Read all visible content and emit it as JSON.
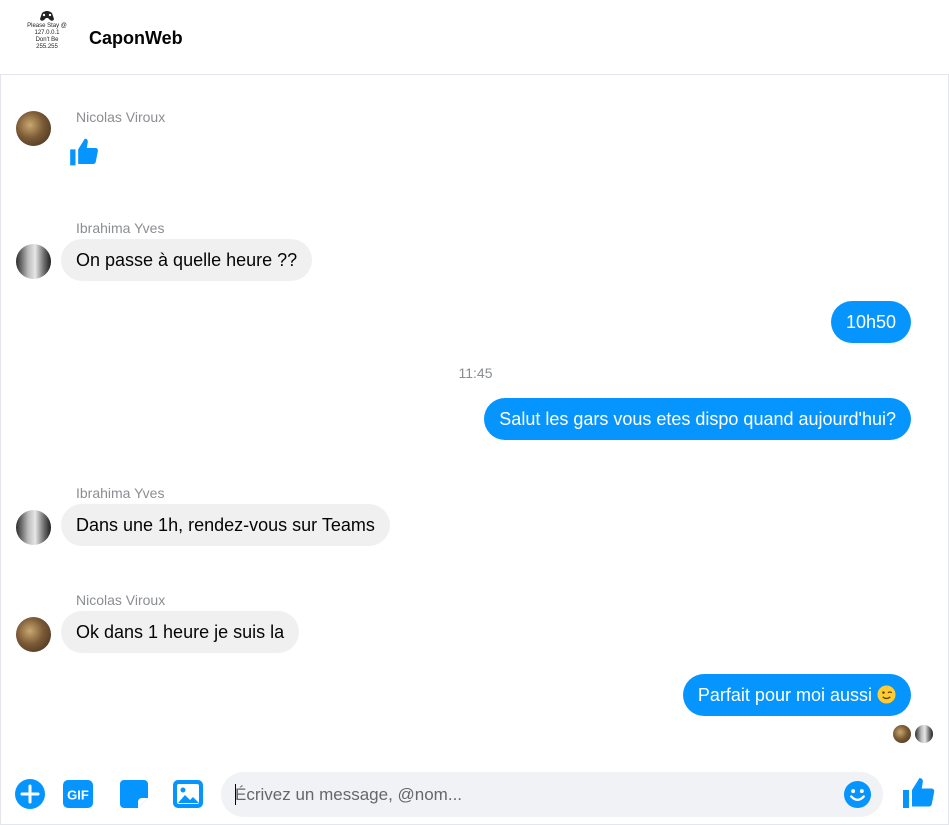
{
  "header": {
    "logo_lines": [
      "Please Stay @",
      "127.0.0.1",
      "Don't Be",
      "255.255"
    ],
    "title": "CaponWeb"
  },
  "messages": [
    {
      "sender": "Nicolas Viroux",
      "content": "like-icon"
    },
    {
      "sender": "Ibrahima Yves",
      "text": "On passe à quelle heure ??"
    },
    {
      "sender": "me",
      "text": "10h50"
    },
    {
      "timestamp": "11:45"
    },
    {
      "sender": "me",
      "text": "Salut les gars vous etes dispo quand aujourd'hui?"
    },
    {
      "sender": "Ibrahima Yves",
      "text": "Dans une 1h, rendez-vous sur Teams"
    },
    {
      "sender": "Nicolas Viroux",
      "text": "Ok dans 1 heure je suis la"
    },
    {
      "sender": "me",
      "text": "Parfait pour moi aussi",
      "emoji": "winking-face"
    }
  ],
  "composer": {
    "placeholder": "Écrivez un message, @nom...",
    "value": "",
    "actions": [
      "plus-icon",
      "gif-icon",
      "sticker-icon",
      "image-icon"
    ],
    "emoji_button": "smiley-icon",
    "send_button": "like-icon"
  },
  "colors": {
    "accent": "#0695ff",
    "incoming_bubble": "#f0f0f0",
    "meta_text": "#8a8d91"
  }
}
